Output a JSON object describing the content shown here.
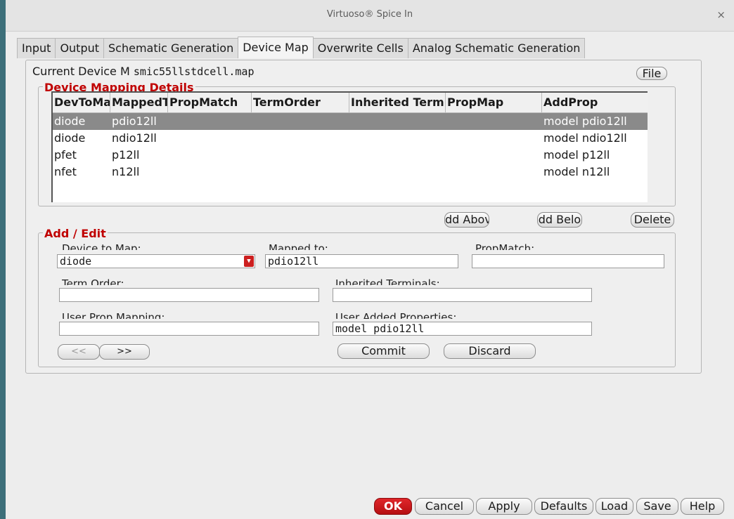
{
  "window": {
    "title": "Virtuoso® Spice In",
    "close": "×"
  },
  "tabs": [
    {
      "label": "Input"
    },
    {
      "label": "Output"
    },
    {
      "label": "Schematic Generation"
    },
    {
      "label": "Device Map"
    },
    {
      "label": "Overwrite Cells"
    },
    {
      "label": "Analog Schematic Generation"
    }
  ],
  "current_device": {
    "label": "Current Device M",
    "value": "smic55llstdcell.map",
    "file_button": "File"
  },
  "mapping": {
    "legend": "Device Mapping Details",
    "columns": [
      "DevToMap",
      "MappedTo",
      "PropMatch",
      "TermOrder",
      "Inherited Terminals",
      "PropMap",
      "AddProp"
    ],
    "rows": [
      [
        "diode",
        "pdio12ll",
        "",
        "",
        "",
        "",
        "model pdio12ll"
      ],
      [
        "diode",
        "ndio12ll",
        "",
        "",
        "",
        "",
        "model ndio12ll"
      ],
      [
        "pfet",
        "p12ll",
        "",
        "",
        "",
        "",
        "model p12ll"
      ],
      [
        "nfet",
        "n12ll",
        "",
        "",
        "",
        "",
        "model n12ll"
      ]
    ],
    "selected_row": 0,
    "add_above": "dd Abov",
    "add_below": "dd Belo",
    "delete": "Delete"
  },
  "edit": {
    "legend": "Add / Edit",
    "device_to_map_label": "Device to Map:",
    "device_to_map_value": "diode",
    "mapped_to_label": "Mapped to:",
    "mapped_to_value": "pdio12ll",
    "prop_match_label": "PropMatch:",
    "prop_match_value": "",
    "term_order_label": "Term Order:",
    "term_order_value": "",
    "inherited_terminals_label": "Inherited Terminals:",
    "inherited_terminals_value": "",
    "user_prop_mapping_label": "User Prop Mapping:",
    "user_prop_mapping_value": "",
    "user_added_properties_label": "User Added Properties:",
    "user_added_properties_value": "model pdio12ll",
    "prev": "<<",
    "next": ">>",
    "commit": "Commit",
    "discard": "Discard"
  },
  "footer": {
    "ok": "OK",
    "cancel": "Cancel",
    "apply": "Apply",
    "defaults": "Defaults",
    "load": "Load",
    "save": "Save",
    "help": "Help"
  },
  "colors": {
    "accent": "#c00000",
    "selected_row": "#8a8a8a",
    "ok_button": "#cc1f1f"
  }
}
